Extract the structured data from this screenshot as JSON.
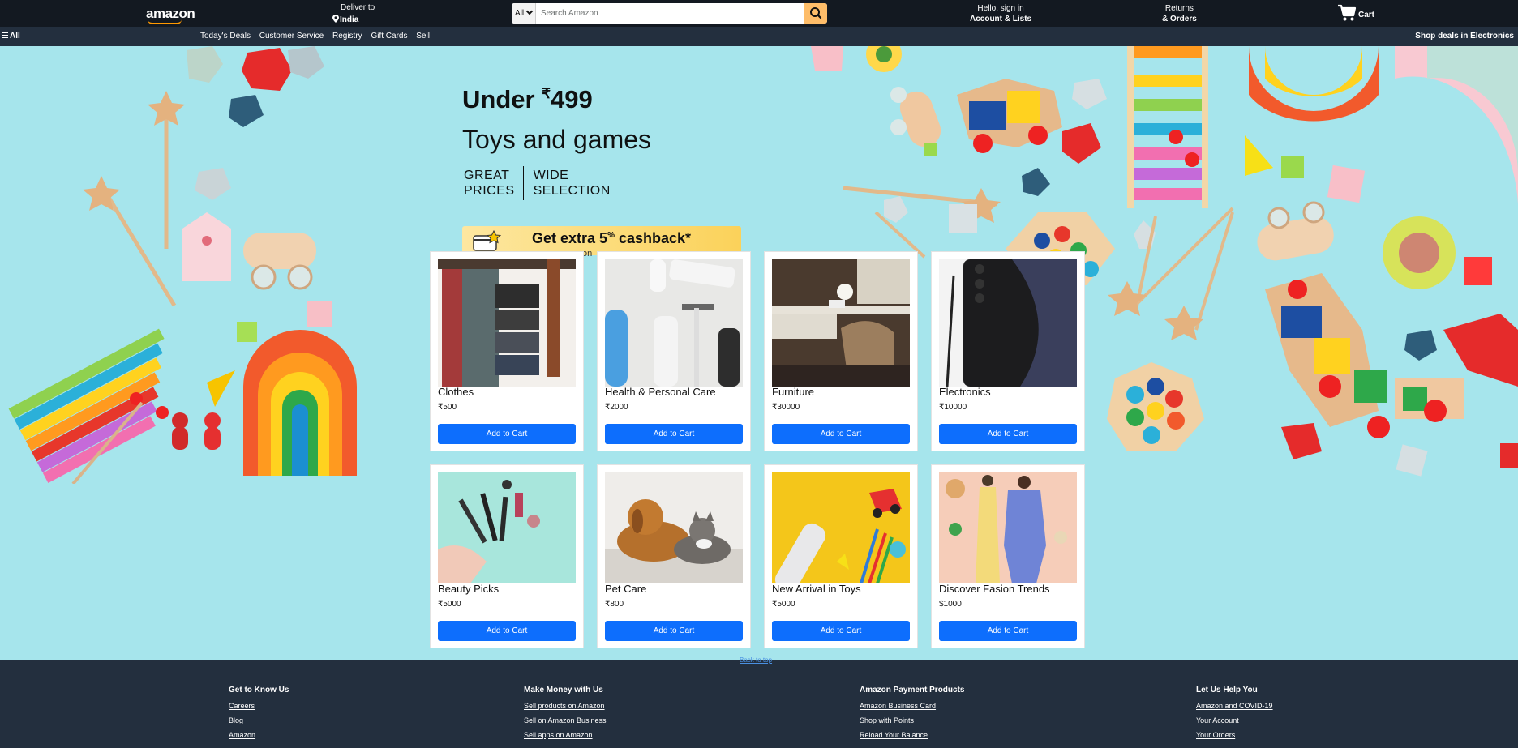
{
  "header": {
    "logo": "amazon",
    "deliver_line1": "Deliver to",
    "deliver_line2": "India",
    "search_category": "All",
    "search_placeholder": "Search Amazon",
    "account_line1": "Hello, sign in",
    "account_line2": "Account & Lists",
    "returns_line1": "Returns",
    "returns_line2": "& Orders",
    "cart_label": "Cart"
  },
  "subnav": {
    "all_label": "All",
    "links": [
      "Today's Deals",
      "Customer Service",
      "Registry",
      "Gift Cards",
      "Sell"
    ],
    "right_link": "Shop deals in Electronics"
  },
  "hero": {
    "under": "Under",
    "currency": "₹",
    "price": "499",
    "subtitle": "Toys and games",
    "tag1_line1": "GREAT",
    "tag1_line2": "PRICES",
    "tag2_line1": "WIDE",
    "tag2_line2": "SELECTION",
    "cashback": "Get extra 5",
    "cashback_pct": "%",
    "cashback_tail": "cashback*",
    "cashback_fragment": "on"
  },
  "products": [
    {
      "name": "Clothes",
      "price": "₹500",
      "button": "Add to Cart"
    },
    {
      "name": "Health & Personal Care",
      "price": "₹2000",
      "button": "Add to Cart"
    },
    {
      "name": "Furniture",
      "price": "₹30000",
      "button": "Add to Cart"
    },
    {
      "name": "Electronics",
      "price": "₹10000",
      "button": "Add to Cart"
    },
    {
      "name": "Beauty Picks",
      "price": "₹5000",
      "button": "Add to Cart"
    },
    {
      "name": "Pet Care",
      "price": "₹800",
      "button": "Add to Cart"
    },
    {
      "name": "New Arrival in Toys",
      "price": "₹5000",
      "button": "Add to Cart"
    },
    {
      "name": "Discover Fasion Trends",
      "price": "$1000",
      "button": "Add to Cart"
    }
  ],
  "back_to_top": "Back to top",
  "footer": {
    "columns": [
      {
        "heading": "Get to Know Us",
        "links": [
          "Careers",
          "Blog",
          "Amazon"
        ]
      },
      {
        "heading": "Make Money with Us",
        "links": [
          "Sell products on Amazon",
          "Sell on Amazon Business",
          "Sell apps on Amazon"
        ]
      },
      {
        "heading": "Amazon Payment Products",
        "links": [
          "Amazon Business Card",
          "Shop with Points",
          "Reload Your Balance"
        ]
      },
      {
        "heading": "Let Us Help You",
        "links": [
          "Amazon and COVID-19",
          "Your Account",
          "Your Orders"
        ]
      }
    ]
  },
  "colors": {
    "topbar": "#131921",
    "subnav": "#232f3e",
    "search_button": "#febd69",
    "add_to_cart": "#0d6efd",
    "hero_bg": "#a6e5ec"
  }
}
